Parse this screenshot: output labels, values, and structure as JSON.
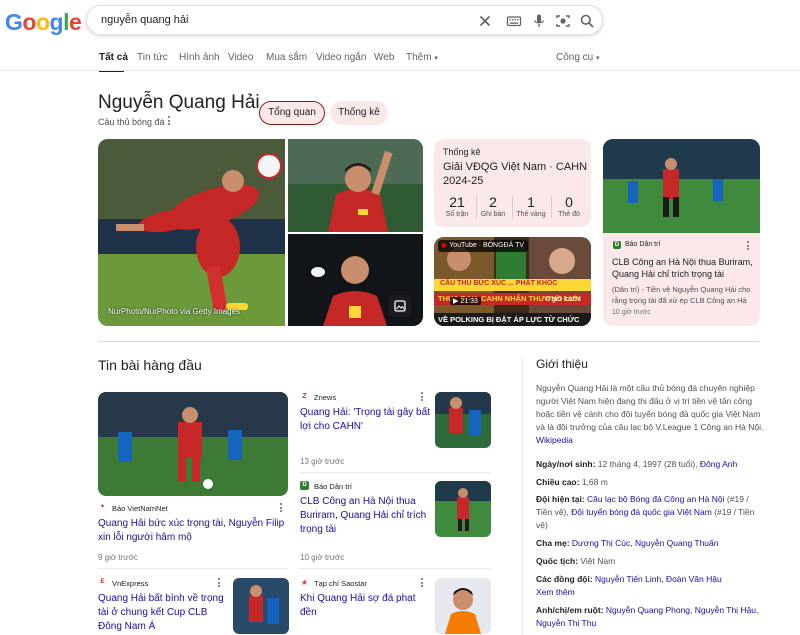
{
  "search": {
    "query": "nguyễn quang hải"
  },
  "logo": {
    "letters": [
      "G",
      "o",
      "o",
      "g",
      "l",
      "e"
    ],
    "colors": [
      "#4285f4",
      "#ea4335",
      "#fbbc05",
      "#4285f4",
      "#34a853",
      "#ea4335"
    ]
  },
  "tabs": [
    {
      "label": "Tất cả",
      "active": true
    },
    {
      "label": "Tin tức"
    },
    {
      "label": "Hình ảnh"
    },
    {
      "label": "Video"
    },
    {
      "label": "Mua sắm"
    },
    {
      "label": "Video ngắn"
    },
    {
      "label": "Web"
    },
    {
      "label": "Thêm"
    }
  ],
  "tools_label": "Công cụ",
  "entity": {
    "name": "Nguyễn Quang Hải",
    "subtitle": "Cầu thủ bóng đá",
    "chips": [
      "Tổng quan",
      "Thống kê"
    ]
  },
  "images": {
    "credit": "NurPhoto/NurPhoto via Getty Images"
  },
  "stats_card": {
    "heading": "Thống kê",
    "line1": "Giải VĐQG Việt Nam · CAHN",
    "line2": "2024-25",
    "items": [
      {
        "value": "21",
        "label": "Số trận"
      },
      {
        "value": "2",
        "label": "Ghi bàn"
      },
      {
        "value": "1",
        "label": "Thẻ vàng"
      },
      {
        "value": "0",
        "label": "Thẻ đỏ"
      }
    ]
  },
  "video_card": {
    "source": "YouTube · BÓNGĐÁ TV",
    "duration": "21:33",
    "ago": "6 giờ trước",
    "caption_top": "CẦU THỦ BỨC XÚC ... PHẢT KHỐC",
    "caption_mid": "THUA ĐAU, CAHN NHẬN THƯƠNG LƯN",
    "caption_bottom": "VỀ POLKING BỊ ĐẶT ÁP LỰC TỪ CHỨC"
  },
  "news_card": {
    "source": "Báo Dân trí",
    "title": "CLB Công an Hà Nội thua Buriram, Quang Hải chỉ trích trọng tài",
    "snippet": "(Dân trí) - Tiền vệ Nguyễn Quang Hải cho rằng trọng tài đã xử ép CLB Công an Hà ...",
    "ago": "10 giờ trước"
  },
  "top_stories": {
    "heading": "Tin bài hàng đầu",
    "featured": {
      "source": "Báo VietNamNet",
      "title": "Quang Hải bức xúc trọng tài, Nguyễn Filip xin lỗi người hâm mộ",
      "ago": "9 giờ trước"
    },
    "side": [
      {
        "source": "Znews",
        "title": "Quang Hải: 'Trọng tài gây bất lợi cho CAHN'",
        "ago": "13 giờ trước"
      },
      {
        "source": "Báo Dân trí",
        "title": "CLB Công an Hà Nội thua Buriram, Quang Hải chỉ trích trọng tài",
        "ago": "10 giờ trước"
      },
      {
        "source": "Tạp chí Saostar",
        "title": "Khi Quang Hải sợ đá phạt đền",
        "ago": ""
      }
    ],
    "bottom_left": {
      "source": "VnExpress",
      "title": "Quang Hải bất bình về trọng tài ở chung kết Cup CLB Đông Nam Á"
    }
  },
  "about": {
    "heading": "Giới thiệu",
    "description": "Nguyễn Quang Hải là một cầu thủ bóng đá chuyên nghiệp người Việt Nam hiện đang thi đấu ở vị trí tiền vệ tấn công hoặc tiền vệ cánh cho đội tuyển bóng đá quốc gia Việt Nam và là đội trưởng của câu lạc bộ V.League 1 Công an Hà Nội.",
    "wiki": "Wikipedia",
    "facts": {
      "birth_label": "Ngày/nơi sinh:",
      "birth_value": "12 tháng 4, 1997 (28 tuổi),",
      "birth_place": "Đông Anh",
      "height_label": "Chiều cao:",
      "height_value": "1,68 m",
      "team_label": "Đội hiện tại:",
      "team_a": "Câu lạc bộ Bóng đá Công an Hà Nội",
      "team_a_num": "(#19 / Tiền vệ),",
      "team_b": "Đội tuyển bóng đá quốc gia Việt Nam",
      "team_b_num": "(#19 / Tiền vệ)",
      "parents_label": "Cha mẹ:",
      "parents_value": "Dương Thị Cúc, Nguyễn Quang Thuấn",
      "nationality_label": "Quốc tịch:",
      "nationality_value": "Việt Nam",
      "teammates_label": "Các đồng đội:",
      "teammates_value": "Nguyễn Tiến Linh, Đoàn Văn Hậu",
      "teammates_more": "Xem thêm",
      "siblings_label": "Anh/chị/em ruột:",
      "siblings_value": "Nguyễn Quang Phong, Nguyễn Thị Hậu, Nguyễn Thị Thụ"
    }
  },
  "icons": [
    "close-icon",
    "keyboard-icon",
    "microphone-icon",
    "camera-search-icon",
    "search-icon",
    "more-vert-icon",
    "image-search-icon",
    "chevron-down-icon"
  ]
}
